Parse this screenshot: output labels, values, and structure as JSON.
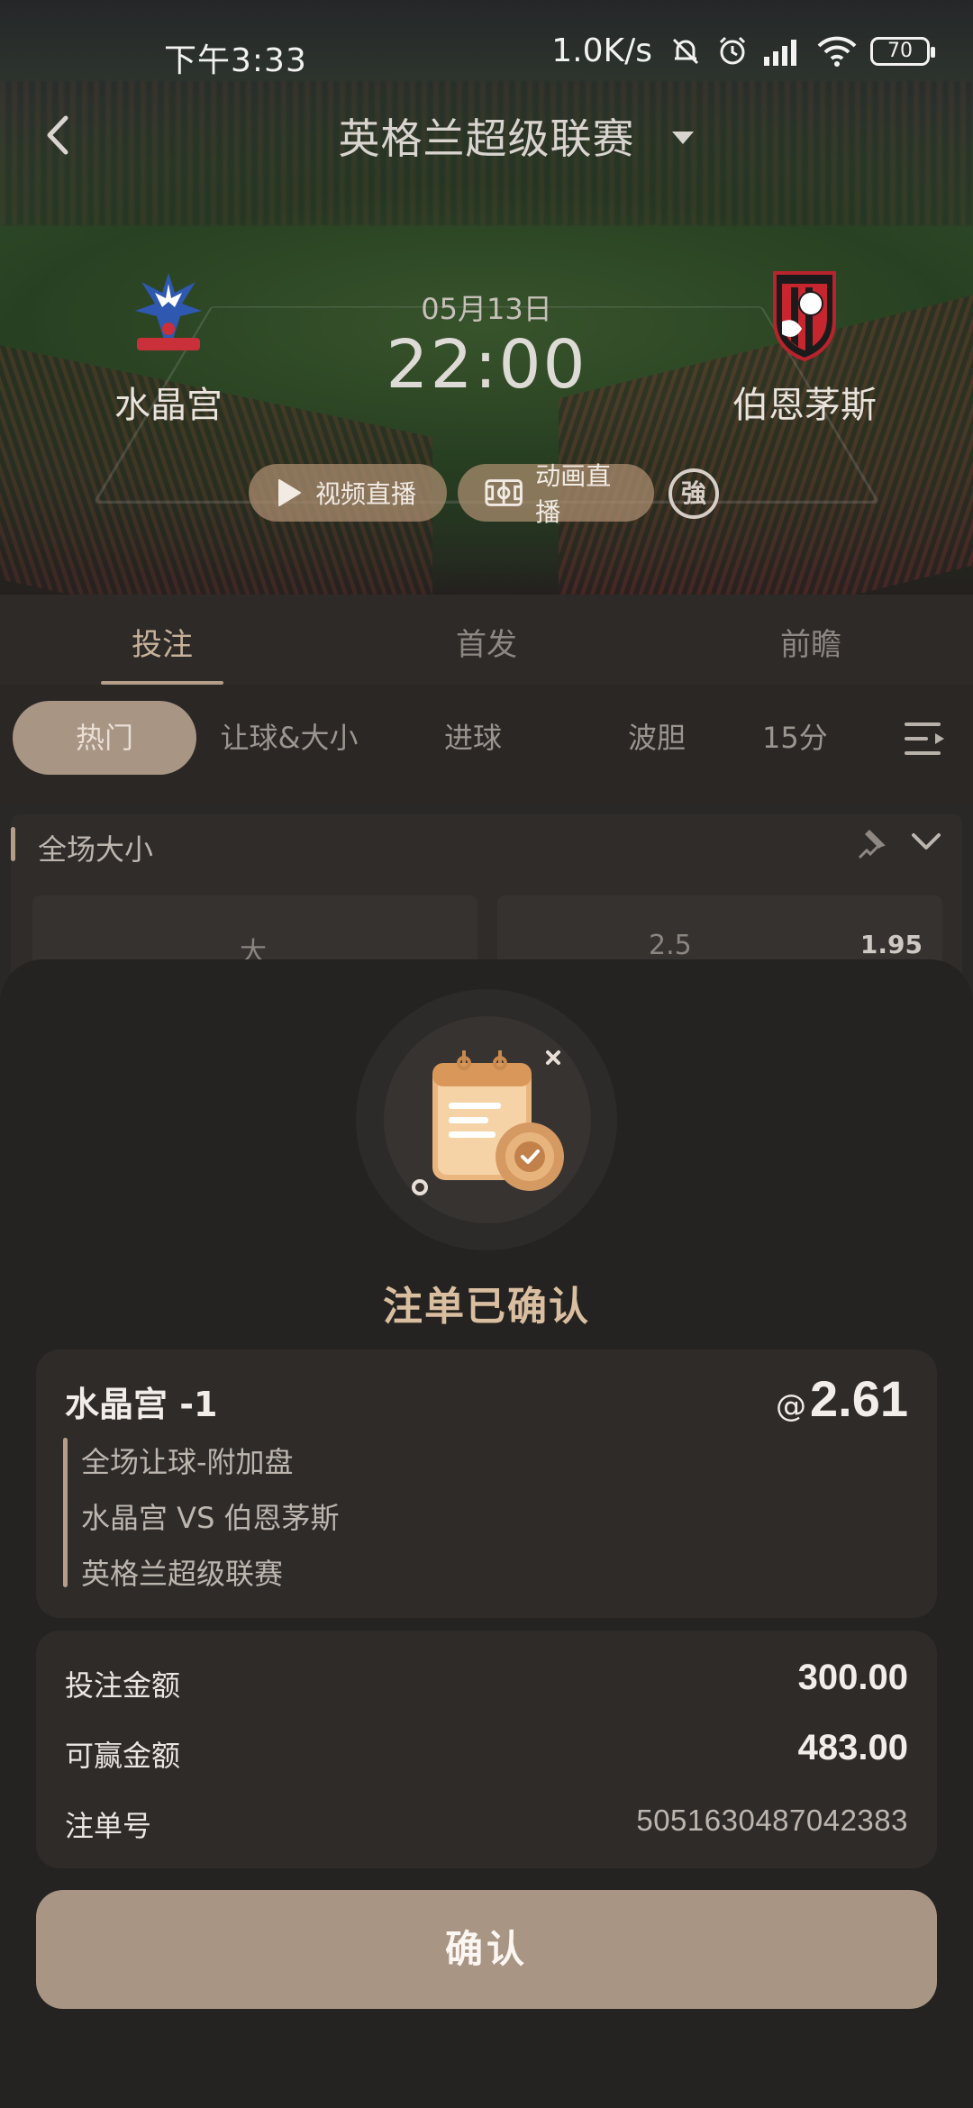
{
  "status_bar": {
    "time": "下午3:33",
    "network_speed": "1.0K/s",
    "battery": "70"
  },
  "header": {
    "title": "英格兰超级联赛"
  },
  "match": {
    "home_team": "水晶宫",
    "away_team": "伯恩茅斯",
    "date": "05月13日",
    "time": "22:00",
    "video_live_label": "视频直播",
    "animation_live_label": "动画直播",
    "strong_badge": "強"
  },
  "tabs": [
    {
      "label": "投注",
      "active": true
    },
    {
      "label": "首发",
      "active": false
    },
    {
      "label": "前瞻",
      "active": false
    }
  ],
  "chips": [
    {
      "label": "热门",
      "active": true
    },
    {
      "label": "让球&大小",
      "active": false
    },
    {
      "label": "进球",
      "active": false
    },
    {
      "label": "波胆",
      "active": false
    },
    {
      "label": "15分",
      "active": false
    }
  ],
  "market": {
    "title": "全场大小",
    "cell_a_label": "大",
    "cell_b_line": "2.5",
    "cell_b_odds": "1.95"
  },
  "modal": {
    "title": "注单已确认",
    "bet": {
      "selection": "水晶宫 -1",
      "at": "@",
      "odds": "2.61",
      "market": "全场让球-附加盘",
      "fixture": "水晶宫 VS 伯恩茅斯",
      "league": "英格兰超级联赛"
    },
    "summary": {
      "stake_label": "投注金额",
      "stake_value": "300.00",
      "win_label": "可赢金额",
      "win_value": "483.00",
      "order_label": "注单号",
      "order_value": "5051630487042383"
    },
    "confirm_label": "确认"
  },
  "colors": {
    "accent": "#a89584",
    "accent_text": "#d9bea0",
    "sheet_bg": "#252321"
  }
}
